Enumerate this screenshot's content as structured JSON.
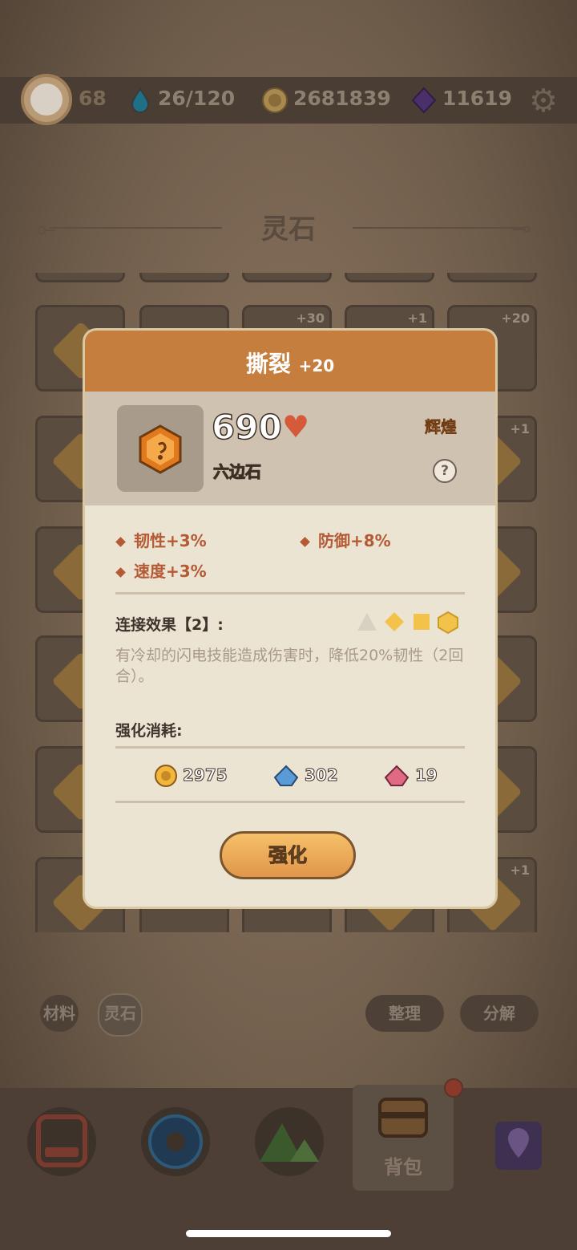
{
  "topbar": {
    "level": "68",
    "stamina": "26/120",
    "coins": "2681839",
    "gems": "11619"
  },
  "section": {
    "title": "灵石"
  },
  "grid": {
    "badges": [
      "+30",
      "+1",
      "+20",
      "+1",
      "+1"
    ]
  },
  "bottom": {
    "tab_material": "材料",
    "tab_spirit_stone": "灵石",
    "sort_label": "整理",
    "decompose_label": "分解",
    "nav_active_label": "背包"
  },
  "dialog": {
    "title": "撕裂",
    "level": "+20",
    "power": "690",
    "stone_type": "六边石",
    "rarity": "辉煌",
    "help": "?",
    "stats": [
      "韧性+3%",
      "防御+8%",
      "速度+3%"
    ],
    "link_title": "连接效果【2】:",
    "link_desc": "有冷却的闪电技能造成伤害时，降低20%韧性（2回合）。",
    "cost_title": "强化消耗:",
    "costs": [
      "2975",
      "302",
      "19"
    ],
    "button": "强化"
  },
  "colors": {
    "header": "#c67e3e",
    "stat": "#b45a34",
    "rarity": "#e08a2c",
    "button": "#f0ae5a"
  }
}
